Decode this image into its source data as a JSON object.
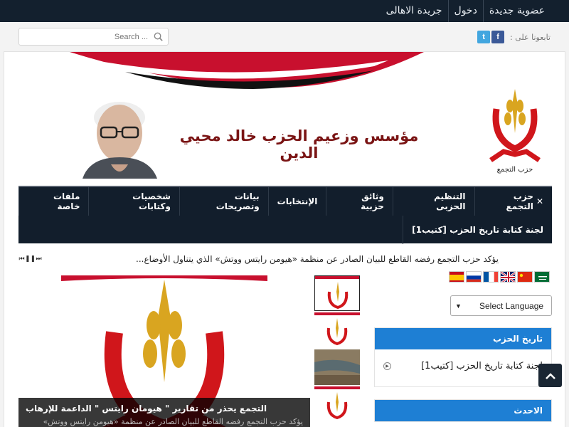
{
  "top_nav": {
    "items": [
      "عضوية جديدة",
      "دخول",
      "جريدة الاهالى"
    ]
  },
  "follow": {
    "label": "تابعونا على :",
    "facebook": "f",
    "twitter": "t"
  },
  "search": {
    "placeholder": "Search ..."
  },
  "banner": {
    "title": "مؤسس وزعيم الحزب  خالد محيي الدين",
    "logo_text": "حزب التجمع"
  },
  "main_nav": {
    "row1": [
      "حزب التجمع",
      "التنظيم الحزبى",
      "وثائق حزبية",
      "الإنتخابات",
      "بيانات وتصريحات",
      "شخصيات وكتابات",
      "ملفات خاصة"
    ],
    "row2": [
      "لجنة كتابة تاريخ الحزب [كتيب1]"
    ]
  },
  "ticker": {
    "text": "يؤكد حزب التجمع رفضه القاطع للبيان الصادر عن منظمة «هيومن رايتس ووتش» الذي يتناول الأوضاع..."
  },
  "slider": {
    "caption_title": "التجمع يحذر من تقارير \" هيومان رايتس \" الداعمة للإرهاب",
    "caption_text": "يؤكد حزب التجمع رفضه القاطع للبيان الصادر عن منظمة «هيومن رايتس ووتش»"
  },
  "translate": {
    "selected": "Select Language",
    "flags": [
      "ar",
      "zh",
      "en",
      "fr",
      "ru",
      "es"
    ]
  },
  "sidebar": {
    "history_title": "تاريخ الحزب",
    "history_item": "لجنة كتابة تاريخ الحزب [كتيب1]",
    "latest_title": "الاحدث"
  },
  "colors": {
    "topbar": "#13202e",
    "nav": "#121e2c",
    "widget_head": "#1e7fd4",
    "flag_red": "#c8102e",
    "logo_red": "#d0161b",
    "logo_gold": "#d9a520"
  }
}
